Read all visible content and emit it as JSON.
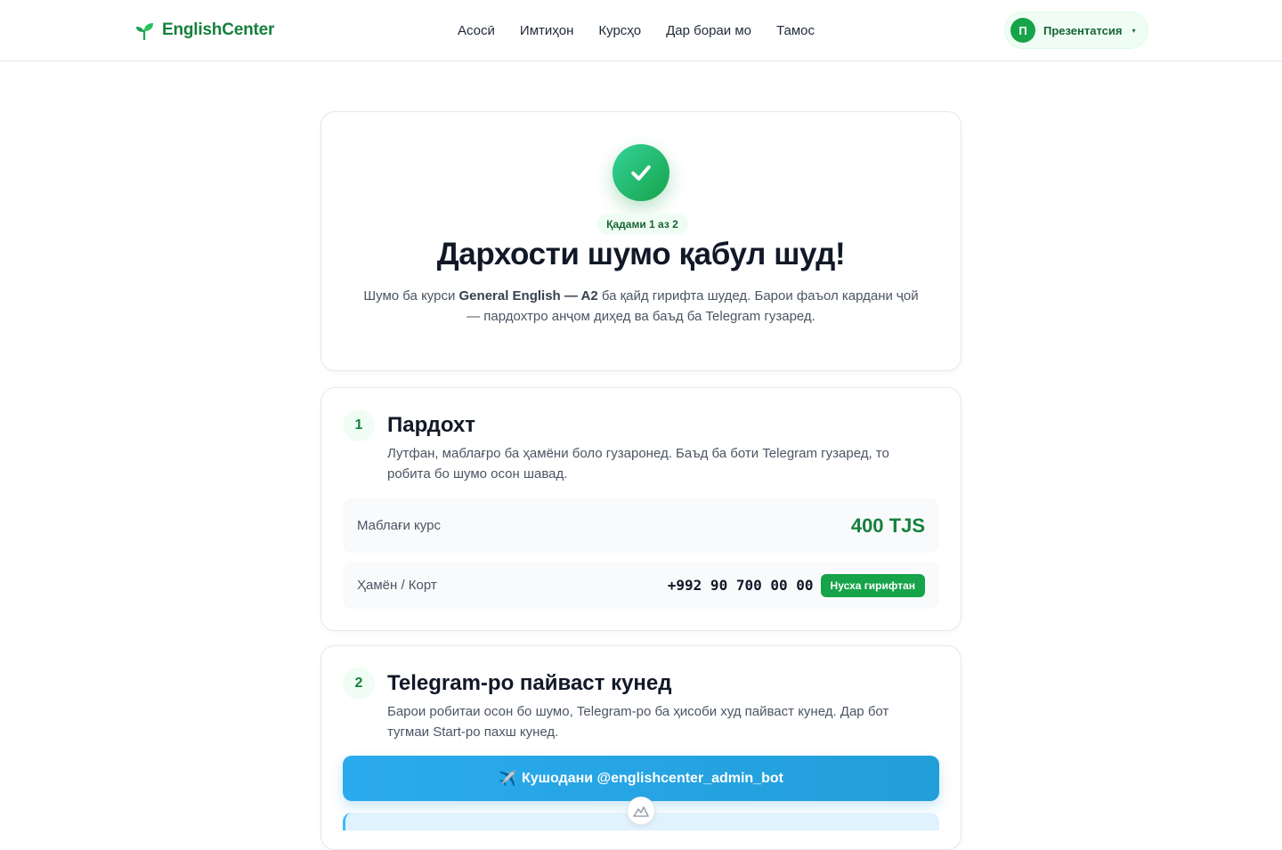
{
  "header": {
    "logo_text": "EnglishCenter",
    "nav": [
      "Асосӣ",
      "Имтиҳон",
      "Курсҳо",
      "Дар бораи мо",
      "Тамос"
    ],
    "profile": {
      "initial": "П",
      "name": "Презентатсия",
      "caret": "▾"
    }
  },
  "hero": {
    "step_badge": "Қадами 1 аз 2",
    "title": "Дархости шумо қабул шуд!",
    "desc_prefix": "Шумо ба курси ",
    "course_name": "General English — A2",
    "desc_suffix": " ба қайд гирифта шудед. Барои фаъол кардани ҷой — пардохтро анҷом диҳед ва баъд ба Telegram гузаред."
  },
  "step1": {
    "number": "1",
    "title": "Пардохт",
    "desc": "Лутфан, маблағро ба ҳамёни боло гузаронед. Баъд ба боти Telegram гузаред, то робита бо шумо осон шавад.",
    "amount_label": "Маблағи курс",
    "amount_value": "400 TJS",
    "wallet_label": "Ҳамён / Корт",
    "wallet_number": "+992 90 700 00 00",
    "copy_label": "Нусха гирифтан"
  },
  "step2": {
    "number": "2",
    "title": "Telegram-ро пайваст кунед",
    "desc": "Барои робитаи осон бо шумо, Telegram-ро ба ҳисоби худ пайваст кунед. Дар бот тугмаи Start-ро пахш кунед.",
    "button_icon": "✈️",
    "button_label": "Кушодани @englishcenter_admin_bot"
  },
  "colors": {
    "brand": "#15803d",
    "accent": "#16a34a",
    "telegram": "#229ed9"
  }
}
